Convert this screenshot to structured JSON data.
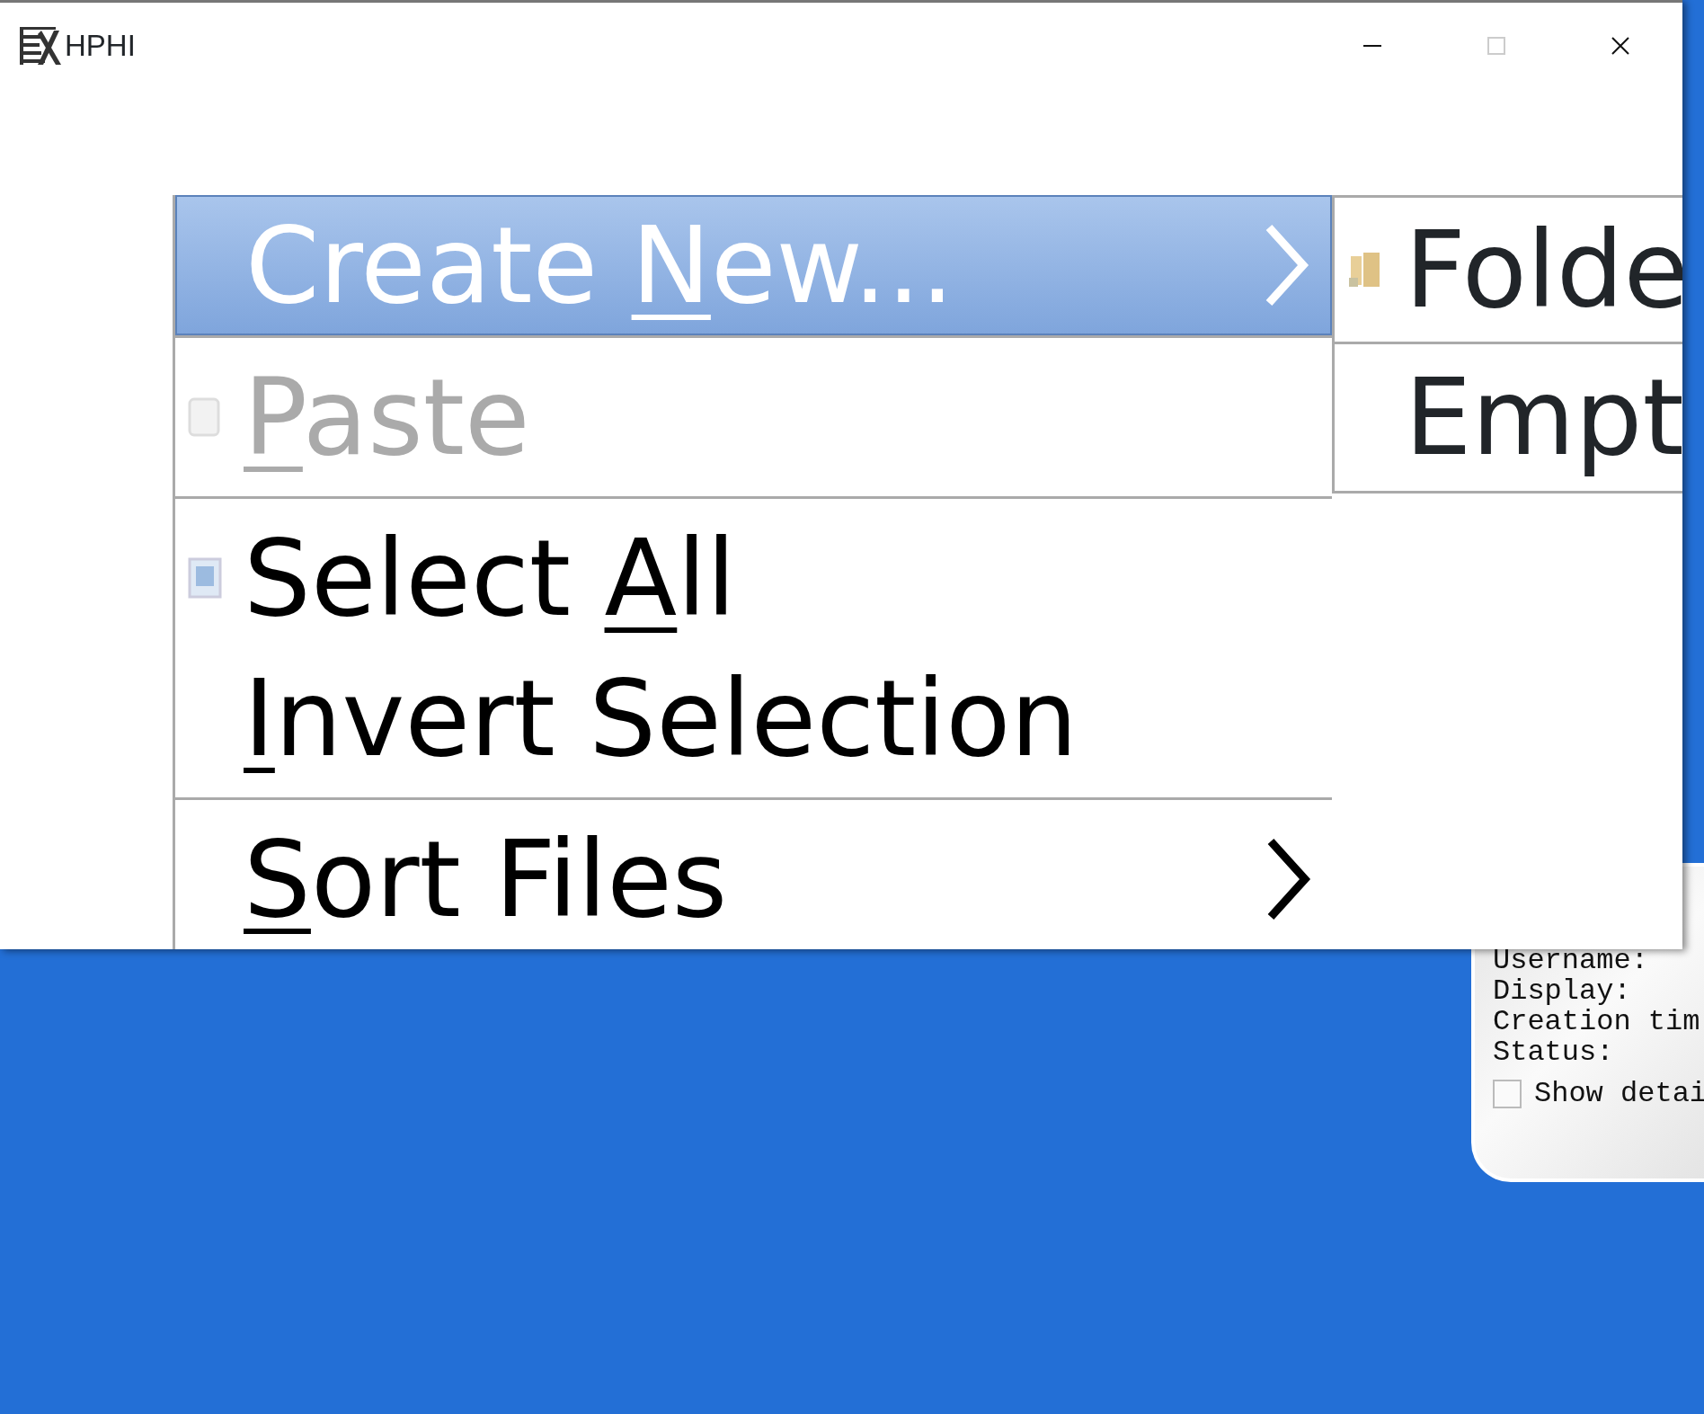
{
  "window": {
    "title": "HPHI",
    "controls": [
      {
        "kind": "minimize",
        "disabled": false
      },
      {
        "kind": "maximize",
        "disabled": true
      },
      {
        "kind": "close",
        "disabled": false
      }
    ]
  },
  "context_menu": {
    "groups": [
      [
        {
          "before": "Create ",
          "mnemonic": "N",
          "after": "ew...",
          "selected": true,
          "disabled": false,
          "submenu": true
        }
      ],
      [
        {
          "mnemonic": "P",
          "after": "aste",
          "selected": false,
          "disabled": true,
          "submenu": false
        }
      ],
      [
        {
          "before": "Select ",
          "mnemonic": "A",
          "after": "ll",
          "selected": false,
          "disabled": false,
          "submenu": false
        },
        {
          "mnemonic": "I",
          "after": "nvert Selection",
          "selected": false,
          "disabled": false,
          "submenu": false
        }
      ],
      [
        {
          "mnemonic": "S",
          "after": "ort Files",
          "selected": false,
          "disabled": false,
          "submenu": true
        }
      ]
    ]
  },
  "submenu": {
    "items": [
      {
        "label": "Folde"
      },
      {
        "label": "Empt"
      }
    ]
  },
  "background_dialog": {
    "lines": [
      "Username:",
      "Display:",
      "Creation tim",
      "Status:"
    ],
    "checkbox": {
      "label": "Show detai",
      "checked": false
    }
  }
}
